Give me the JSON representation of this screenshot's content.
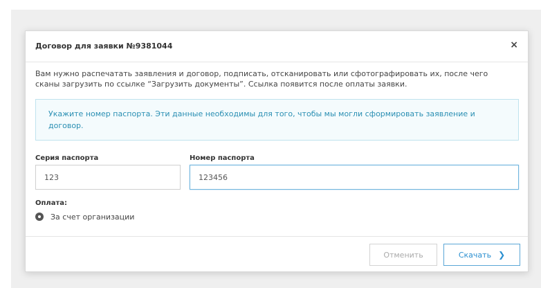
{
  "modal": {
    "title": "Договор для заявки №9381044",
    "close_glyph": "×",
    "intro": "Вам нужно распечатать заявления и договор, подписать, отсканировать или сфотографировать их, после чего сканы загрузить по ссылке “Загрузить документы”. Ссылка появится после оплаты заявки.",
    "info": "Укажите номер паспорта. Эти данные необходимы для того, чтобы мы могли сформировать заявление и договор.",
    "passport_series": {
      "label": "Серия паспорта",
      "value": "123"
    },
    "passport_number": {
      "label": "Номер паспорта",
      "value": "123456"
    },
    "payment": {
      "label": "Оплата:",
      "option": "За счет организации",
      "selected": true
    },
    "buttons": {
      "cancel": "Отменить",
      "download": "Скачать",
      "download_icon": "chevron-right-icon"
    }
  },
  "colors": {
    "info_text": "#2a8fb3",
    "info_bg": "#f4fbfd",
    "info_border": "#bfe3ee",
    "primary": "#2a8fd0"
  }
}
